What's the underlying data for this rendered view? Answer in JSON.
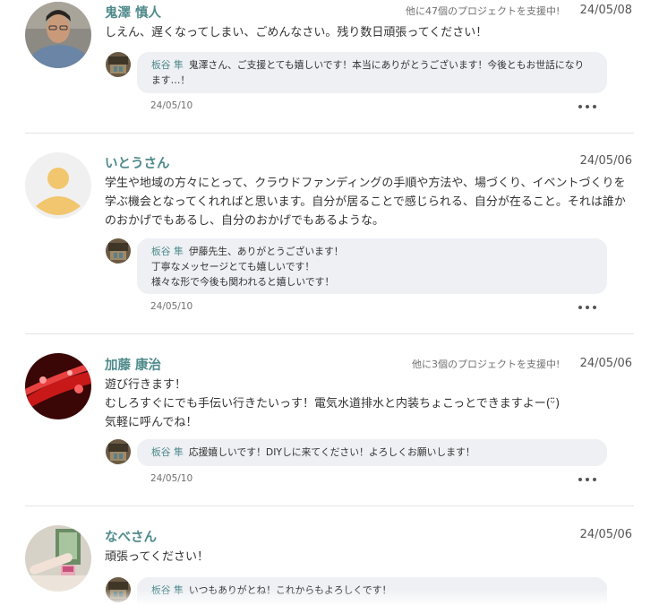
{
  "comments": [
    {
      "name": "鬼澤 慎人",
      "backing": "他に47個のプロジェクトを支援中!",
      "date": "24/05/08",
      "avatar_icon": "user-photo-man-glasses",
      "message": "しえん、遅くなってしまい、ごめんなさい。残り数日頑張ってください！",
      "reply": {
        "name": "板谷 隼",
        "text": "鬼澤さん、ご支援とても嬉しいです！本当にありがとうございます！今後ともお世話になります…！",
        "date": "24/05/10"
      }
    },
    {
      "name": "いとうさん",
      "backing": "",
      "date": "24/05/06",
      "avatar_icon": "default-user-icon",
      "message": "学生や地域の方々にとって、クラウドファンディングの手順や方法や、場づくり、イベントづくりを学ぶ機会となってくれればと思います。自分が居ることで感じられる、自分が在ること。それは誰かのおかげでもあるし、自分のおかげでもあるような。",
      "reply": {
        "name": "板谷 隼",
        "text": "伊藤先生、ありがとうございます！\n丁寧なメッセージとても嬉しいです！\n様々な形で今後も関われると嬉しいです！",
        "date": "24/05/10"
      }
    },
    {
      "name": "加藤 康治",
      "backing": "他に3個のプロジェクトを支援中!",
      "date": "24/05/06",
      "avatar_icon": "user-photo-red-lights",
      "message": "遊び行きます！\nむしろすぐにでも手伝い行きたいっす！電気水道排水と内装ちょこっとできますよー(ᵕ̈)\n気軽に呼んでね！",
      "reply": {
        "name": "板谷 隼",
        "text": "応援嬉しいです！DIYしに来てください！よろしくお願いします！",
        "date": "24/05/10"
      }
    },
    {
      "name": "なべさん",
      "backing": "",
      "date": "24/05/06",
      "avatar_icon": "user-photo-drink",
      "message": "頑張ってください！",
      "reply": {
        "name": "板谷 隼",
        "text": "いつもありがとね！これからもよろしくです！",
        "date": ""
      }
    }
  ],
  "colors": {
    "name": "#4f8a8b",
    "bubble": "#eef0f4",
    "divider": "#e4e4e4"
  }
}
